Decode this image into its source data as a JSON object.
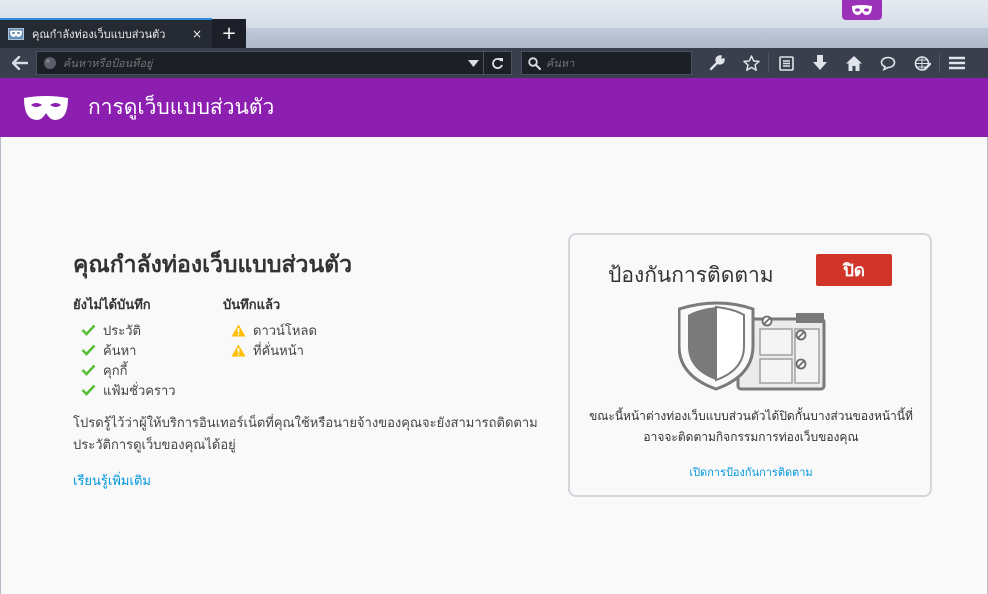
{
  "window": {
    "private_badge_icon": "mask-icon"
  },
  "tab": {
    "title": "คุณกำลังท่องเว็บแบบส่วนตัว",
    "close_icon": "×",
    "new_tab_icon": "+"
  },
  "navbar": {
    "url_placeholder": "ค้นหาหรือป้อนที่อยู่",
    "search_placeholder": "ค้นหา"
  },
  "banner": {
    "title": "การดูเว็บแบบส่วนตัว",
    "icon": "mask-icon",
    "color": "#8c1fb0"
  },
  "main": {
    "heading": "คุณกำลังท่องเว็บแบบส่วนตัว",
    "not_saved": {
      "heading": "ยังไม่ได้บันทึก",
      "items": [
        "ประวัติ",
        "ค้นหา",
        "คุกกี้",
        "แฟ้มชั่วคราว"
      ]
    },
    "saved": {
      "heading": "บันทึกแล้ว",
      "items": [
        "ดาวน์โหลด",
        "ที่คั่นหน้า"
      ]
    },
    "note": "โปรดรู้ไว้ว่าผู้ให้บริการอินเทอร์เน็ตที่คุณใช้หรือนายจ้างของคุณจะยังสามารถติดตามประวัติการดูเว็บของคุณได้อยู่",
    "learn_more": "เรียนรู้เพิ่มเติม"
  },
  "tracking": {
    "title": "ป้องกันการติดตาม",
    "toggle_label": "ปิด",
    "toggle_color": "#d1352a",
    "description": "ขณะนี้หน้าต่างท่องเว็บแบบส่วนตัวได้ปิดกั้นบางส่วนของหน้านี้ที่อาจจะติดตามกิจกรรมการท่องเว็บของคุณ",
    "link": "เปิดการป้องกันการติดตาม"
  },
  "colors": {
    "check": "#57bd35",
    "warning": "#ffbf00",
    "link": "#0096dd"
  }
}
